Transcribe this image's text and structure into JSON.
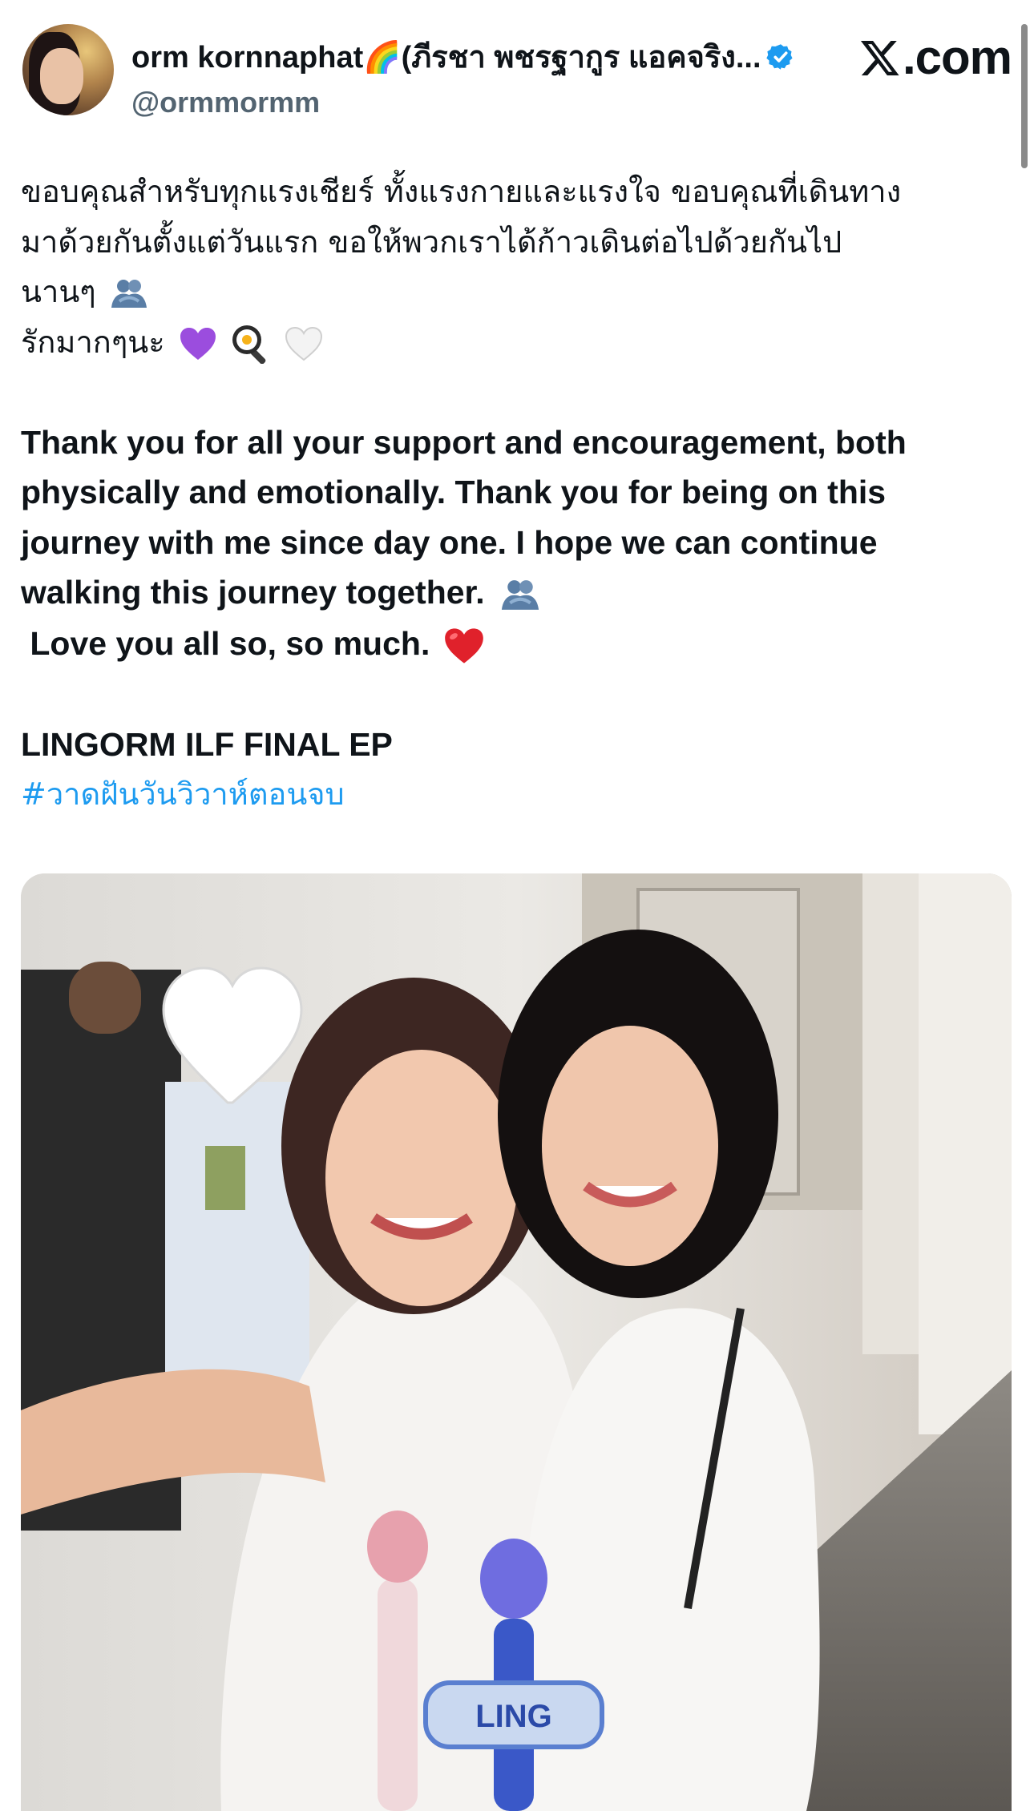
{
  "header": {
    "display_name": "orm kornnaphat🌈(ภีรชา พชรฐากูร แอคจริง...",
    "handle": "@ormmormm",
    "brand": ".com",
    "avatar": "profile-photo"
  },
  "tweet": {
    "thai_lines": [
      "ขอบคุณสำหรับทุกแรงเชียร์ ทั้งแรงกายและแรงใจ ขอบคุณที่เดินทาง",
      "มาด้วยกันตั้งแต่วันแรก ขอให้พวกเราได้ก้าวเดินต่อไปด้วยกันไป",
      "นานๆ",
      "รักมากๆนะ"
    ],
    "english_lines": [
      "Thank you for all your support and encouragement, both",
      "physically and emotionally. Thank you for being on this",
      "journey with me since day one. I hope we can continue",
      "walking this journey together.",
      " Love you all so, so much."
    ],
    "title_line": "LINGORM ILF FINAL EP",
    "hashtag": "#วาดฝันวันวิวาห์ตอนจบ",
    "emojis": [
      "people-hugging",
      "purple-heart",
      "cooking-egg",
      "white-heart",
      "red-heart"
    ]
  },
  "photo": {
    "description_icon": "selfie-photo",
    "sticker": "white-heart",
    "mic_label": "LING"
  },
  "colors": {
    "text": "#0f1419",
    "secondary": "#536471",
    "link": "#1d9bf0",
    "verified": "#1d9bf0"
  }
}
